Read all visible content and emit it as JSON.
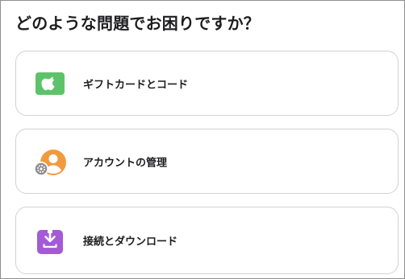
{
  "page": {
    "title": "どのような問題でお困りですか？"
  },
  "options": [
    {
      "label": "ギフトカードとコード",
      "icon": "gift-card-icon",
      "color": "#5ec26a"
    },
    {
      "label": "アカウントの管理",
      "icon": "account-settings-icon",
      "color": "#f19a3e"
    },
    {
      "label": "接続とダウンロード",
      "icon": "download-icon",
      "color": "#a45ad7"
    }
  ]
}
